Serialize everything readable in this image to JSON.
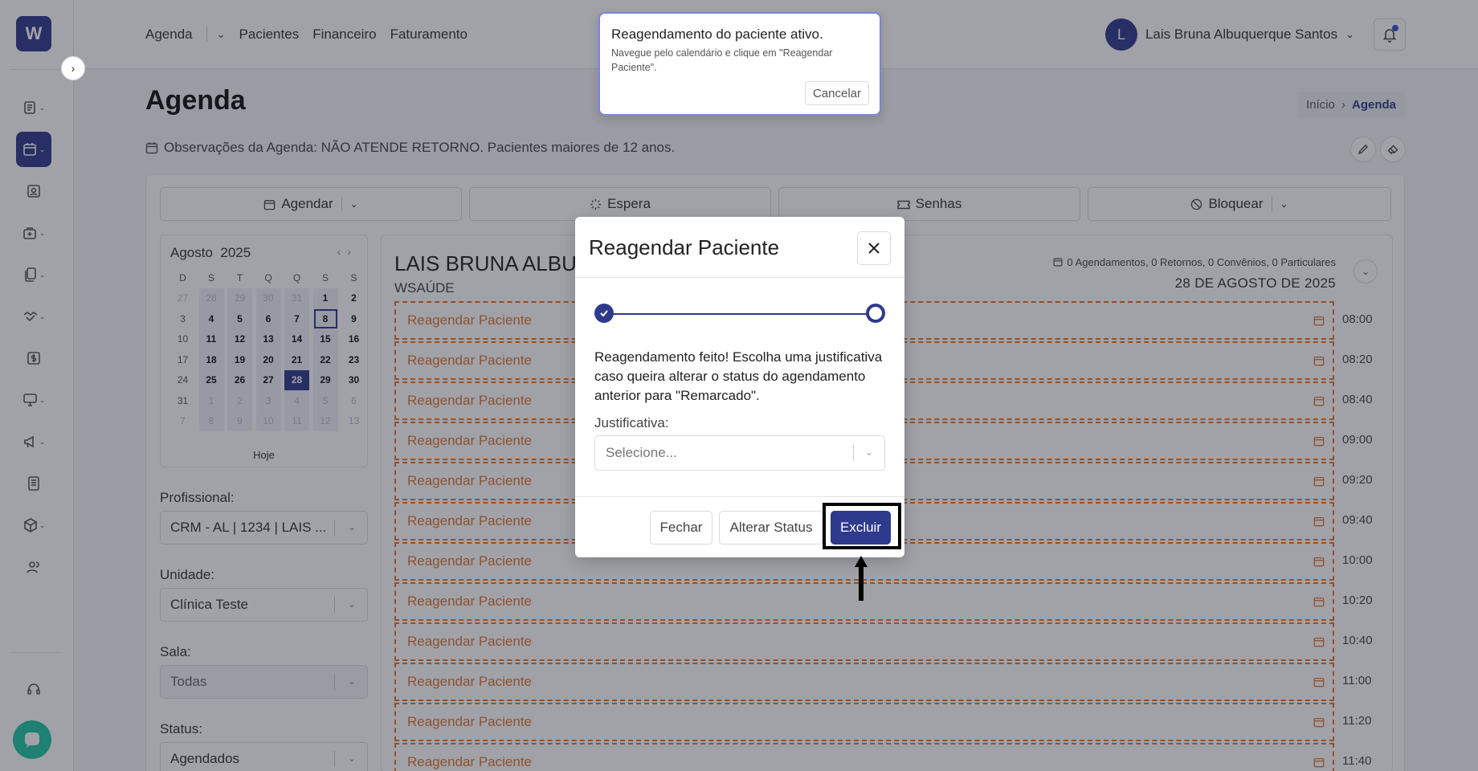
{
  "sidebar": {
    "logo": "W",
    "items": [
      {
        "name": "list-icon"
      },
      {
        "name": "calendar-icon",
        "active": true
      },
      {
        "name": "patient-id-icon"
      },
      {
        "name": "medical-kit-icon"
      },
      {
        "name": "documents-icon"
      },
      {
        "name": "handshake-icon"
      },
      {
        "name": "dollar-icon"
      },
      {
        "name": "monitor-icon"
      },
      {
        "name": "megaphone-icon"
      },
      {
        "name": "report-icon"
      },
      {
        "name": "package-icon"
      },
      {
        "name": "users-icon"
      }
    ]
  },
  "topnav": {
    "links": [
      "Agenda",
      "Pacientes",
      "Financeiro",
      "Faturamento"
    ],
    "user_initial": "L",
    "user_name": "Lais Bruna Albuquerque Santos"
  },
  "page": {
    "title": "Agenda",
    "breadcrumb_home": "Início",
    "breadcrumb_current": "Agenda",
    "observations": "Observações da Agenda: NÃO ATENDE RETORNO. Pacientes maiores de 12 anos."
  },
  "toolbar": {
    "agendar": "Agendar",
    "espera": "Espera",
    "senhas": "Senhas",
    "bloquear": "Bloquear"
  },
  "calendar": {
    "month": "Agosto",
    "year": "2025",
    "weekdays": [
      "D",
      "S",
      "T",
      "Q",
      "Q",
      "S",
      "S"
    ],
    "weeks": [
      [
        "27",
        "28",
        "29",
        "30",
        "31",
        "1",
        "2"
      ],
      [
        "3",
        "4",
        "5",
        "6",
        "7",
        "8",
        "9"
      ],
      [
        "10",
        "11",
        "12",
        "13",
        "14",
        "15",
        "16"
      ],
      [
        "17",
        "18",
        "19",
        "20",
        "21",
        "22",
        "23"
      ],
      [
        "24",
        "25",
        "26",
        "27",
        "28",
        "29",
        "30"
      ],
      [
        "31",
        "1",
        "2",
        "3",
        "4",
        "5",
        "6"
      ],
      [
        "7",
        "8",
        "9",
        "10",
        "11",
        "12",
        "13"
      ]
    ],
    "today_label": "Hoje"
  },
  "filters": {
    "profissional_label": "Profissional:",
    "profissional_value": "CRM - AL | 1234 | LAIS ...",
    "unidade_label": "Unidade:",
    "unidade_value": "Clínica Teste",
    "sala_label": "Sala:",
    "sala_value": "Todas",
    "status_label": "Status:",
    "status_value": "Agendados"
  },
  "schedule": {
    "doctor_name": "LAIS BRUNA ALBU",
    "doctor_sub": "WSAÚDE",
    "stats": "0 Agendamentos, 0 Retornos, 0 Convênios, 0 Particulares",
    "date": "28 DE AGOSTO DE 2025",
    "slot_label": "Reagendar Paciente",
    "times": [
      "08:00",
      "08:20",
      "08:40",
      "09:00",
      "09:20",
      "09:40",
      "10:00",
      "10:20",
      "10:40",
      "11:00",
      "11:20",
      "11:40"
    ]
  },
  "toast": {
    "title": "Reagendamento do paciente ativo.",
    "text": "Navegue pelo calendário e clique em \"Reagendar Paciente\".",
    "cancel": "Cancelar"
  },
  "modal": {
    "title": "Reagendar Paciente",
    "message": "Reagendamento feito! Escolha uma justificativa caso queira alterar o status do agendamento anterior para \"Remarcado\".",
    "justificativa_label": "Justificativa:",
    "select_placeholder": "Selecione...",
    "fechar": "Fechar",
    "alterar_status": "Alterar Status",
    "excluir": "Excluir"
  },
  "colors": {
    "primary": "#2e3a8c",
    "slot": "#e0762f",
    "chat": "#20c4a6"
  }
}
